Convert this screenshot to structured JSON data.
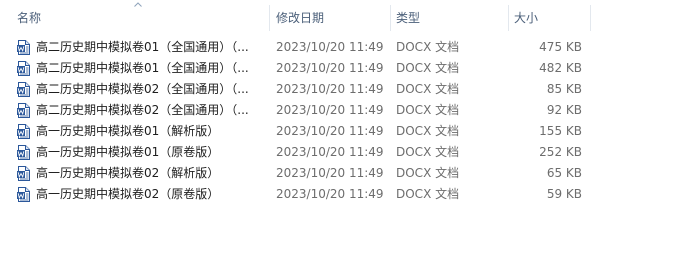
{
  "columns": {
    "name": "名称",
    "date_modified": "修改日期",
    "type": "类型",
    "size": "大小"
  },
  "sort_indicator": "up-arrow-icon",
  "files": [
    {
      "name": "高二历史期中模拟卷01（全国通用）（...",
      "date": "2023/10/20 11:49",
      "type": "DOCX 文档",
      "size": "475 KB",
      "icon": "word-doc-icon"
    },
    {
      "name": "高二历史期中模拟卷01（全国通用）（...",
      "date": "2023/10/20 11:49",
      "type": "DOCX 文档",
      "size": "482 KB",
      "icon": "word-doc-icon"
    },
    {
      "name": "高二历史期中模拟卷02（全国通用）（...",
      "date": "2023/10/20 11:49",
      "type": "DOCX 文档",
      "size": "85 KB",
      "icon": "word-doc-icon"
    },
    {
      "name": "高二历史期中模拟卷02（全国通用）（...",
      "date": "2023/10/20 11:49",
      "type": "DOCX 文档",
      "size": "92 KB",
      "icon": "word-doc-icon"
    },
    {
      "name": "高一历史期中模拟卷01（解析版）",
      "date": "2023/10/20 11:49",
      "type": "DOCX 文档",
      "size": "155 KB",
      "icon": "word-doc-icon"
    },
    {
      "name": "高一历史期中模拟卷01（原卷版）",
      "date": "2023/10/20 11:49",
      "type": "DOCX 文档",
      "size": "252 KB",
      "icon": "word-doc-icon"
    },
    {
      "name": "高一历史期中模拟卷02（解析版）",
      "date": "2023/10/20 11:49",
      "type": "DOCX 文档",
      "size": "65 KB",
      "icon": "word-doc-icon"
    },
    {
      "name": "高一历史期中模拟卷02（原卷版）",
      "date": "2023/10/20 11:49",
      "type": "DOCX 文档",
      "size": "59 KB",
      "icon": "word-doc-icon"
    }
  ]
}
